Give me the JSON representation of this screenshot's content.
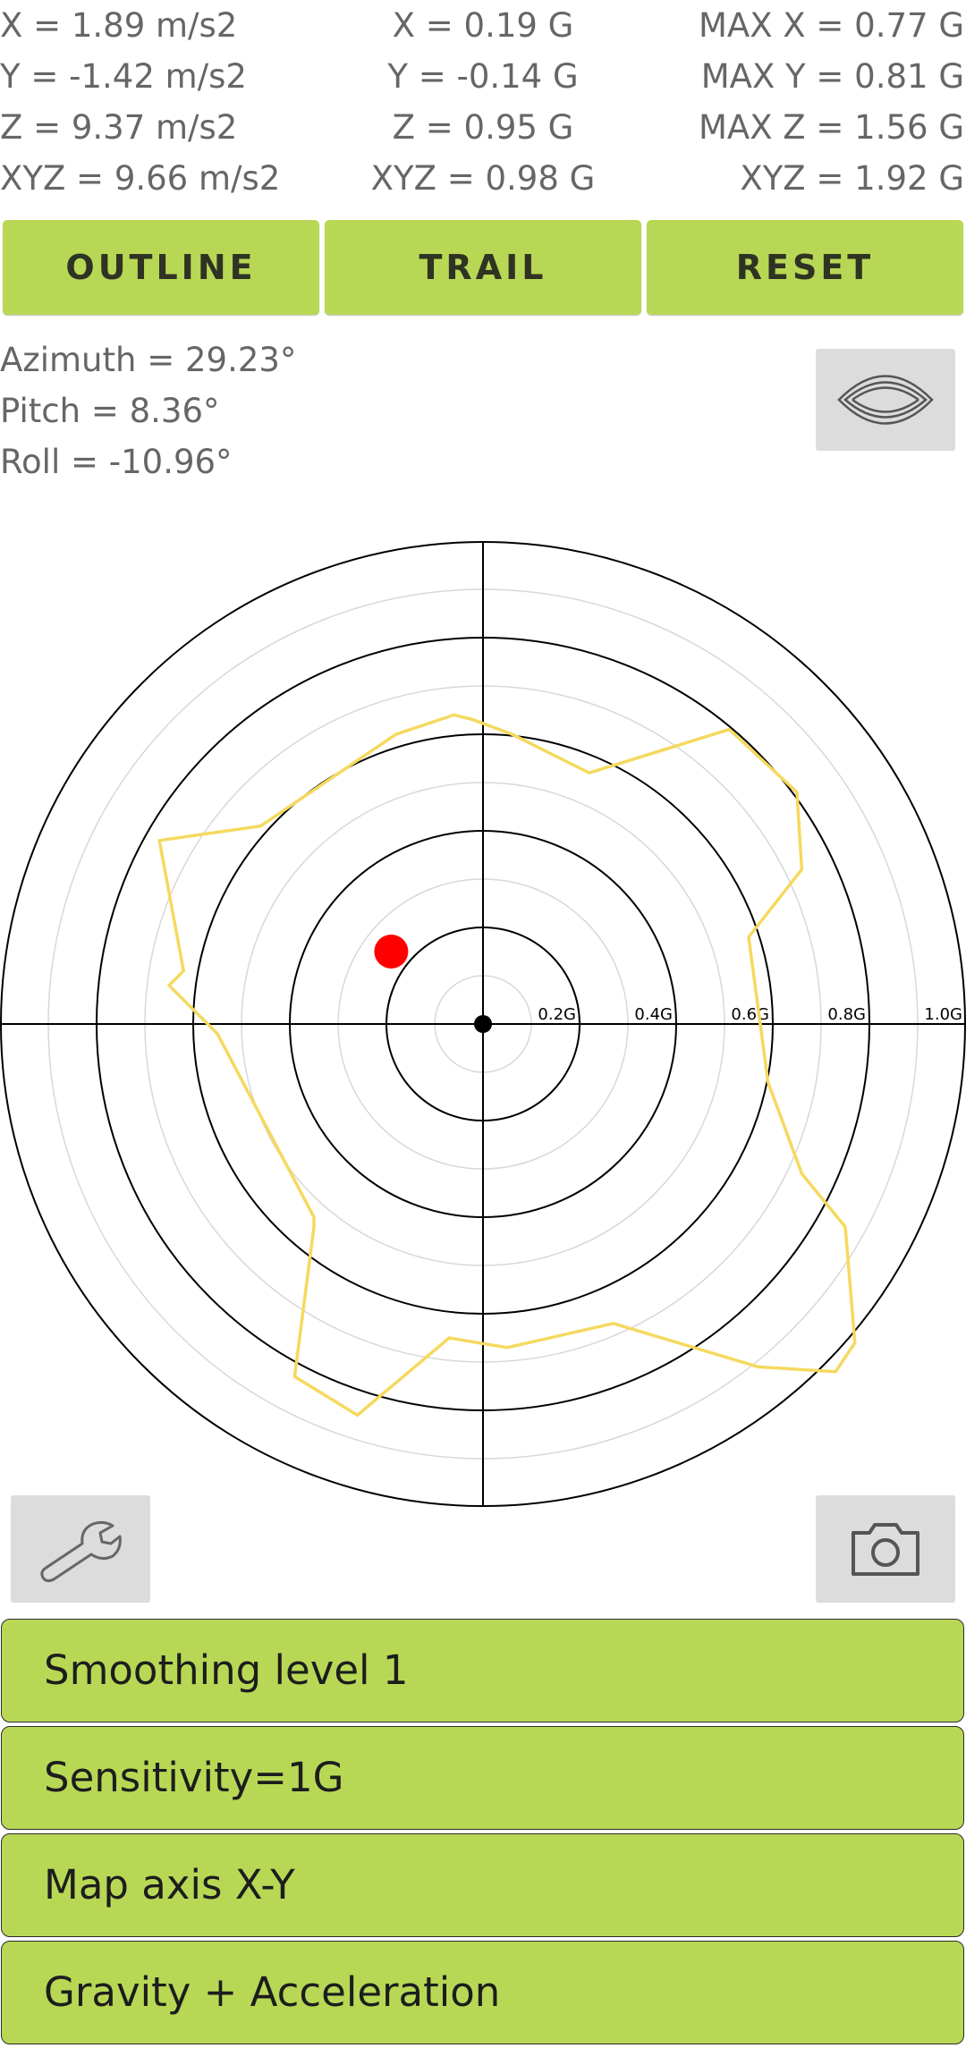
{
  "readouts": {
    "ms2": {
      "x": "X = 1.89 m/s2",
      "y": "Y = -1.42 m/s2",
      "z": "Z = 9.37 m/s2",
      "xyz": "XYZ = 9.66 m/s2"
    },
    "g": {
      "x": "X = 0.19 G",
      "y": "Y = -0.14 G",
      "z": "Z = 0.95 G",
      "xyz": "XYZ = 0.98 G"
    },
    "max": {
      "x": "MAX X = 0.77 G",
      "y": "MAX Y = 0.81 G",
      "z": "MAX Z = 1.56 G",
      "xyz": "XYZ = 1.92 G"
    }
  },
  "buttons": {
    "outline": "OUTLINE",
    "trail": "TRAIL",
    "reset": "RESET"
  },
  "orientation": {
    "azimuth": "Azimuth = 29.23°",
    "pitch": "Pitch = 8.36°",
    "roll": "Roll = -10.96°"
  },
  "icons": {
    "view_toggle": "view-toggle-icon",
    "settings": "wrench-icon",
    "camera": "camera-icon"
  },
  "chart_data": {
    "type": "scatter",
    "title": "",
    "xlabel": "",
    "ylabel": "",
    "ring_labels": [
      "0.2G",
      "0.4G",
      "0.6G",
      "0.8G",
      "1.0G"
    ],
    "range_g": [
      0,
      1.0
    ],
    "grid": true,
    "current_point": {
      "x": -0.19,
      "y": 0.15
    },
    "outline": [
      [
        -0.02,
        0.63
      ],
      [
        0.06,
        0.6
      ],
      [
        0.22,
        0.52
      ],
      [
        0.51,
        0.61
      ],
      [
        0.65,
        0.48
      ],
      [
        0.66,
        0.32
      ],
      [
        0.55,
        0.18
      ],
      [
        0.59,
        -0.12
      ],
      [
        0.66,
        -0.31
      ],
      [
        0.75,
        -0.42
      ],
      [
        0.77,
        -0.66
      ],
      [
        0.73,
        -0.72
      ],
      [
        0.57,
        -0.71
      ],
      [
        0.27,
        -0.62
      ],
      [
        0.05,
        -0.67
      ],
      [
        -0.07,
        -0.65
      ],
      [
        -0.26,
        -0.81
      ],
      [
        -0.39,
        -0.73
      ],
      [
        -0.35,
        -0.42
      ],
      [
        -0.35,
        -0.4
      ],
      [
        -0.55,
        -0.02
      ],
      [
        -0.65,
        0.08
      ],
      [
        -0.62,
        0.11
      ],
      [
        -0.67,
        0.38
      ],
      [
        -0.46,
        0.41
      ],
      [
        -0.18,
        0.6
      ],
      [
        -0.06,
        0.64
      ],
      [
        -0.02,
        0.63
      ]
    ],
    "colors": {
      "outline": "#f5d95f",
      "point": "#ff0000",
      "rings": "#000000",
      "minor_rings": "#d8d8d8"
    }
  },
  "menu": {
    "smoothing": "Smoothing level 1",
    "sensitivity": "Sensitivity=1G",
    "map_axis": "Map axis X-Y",
    "gravity": "Gravity + Acceleration"
  }
}
